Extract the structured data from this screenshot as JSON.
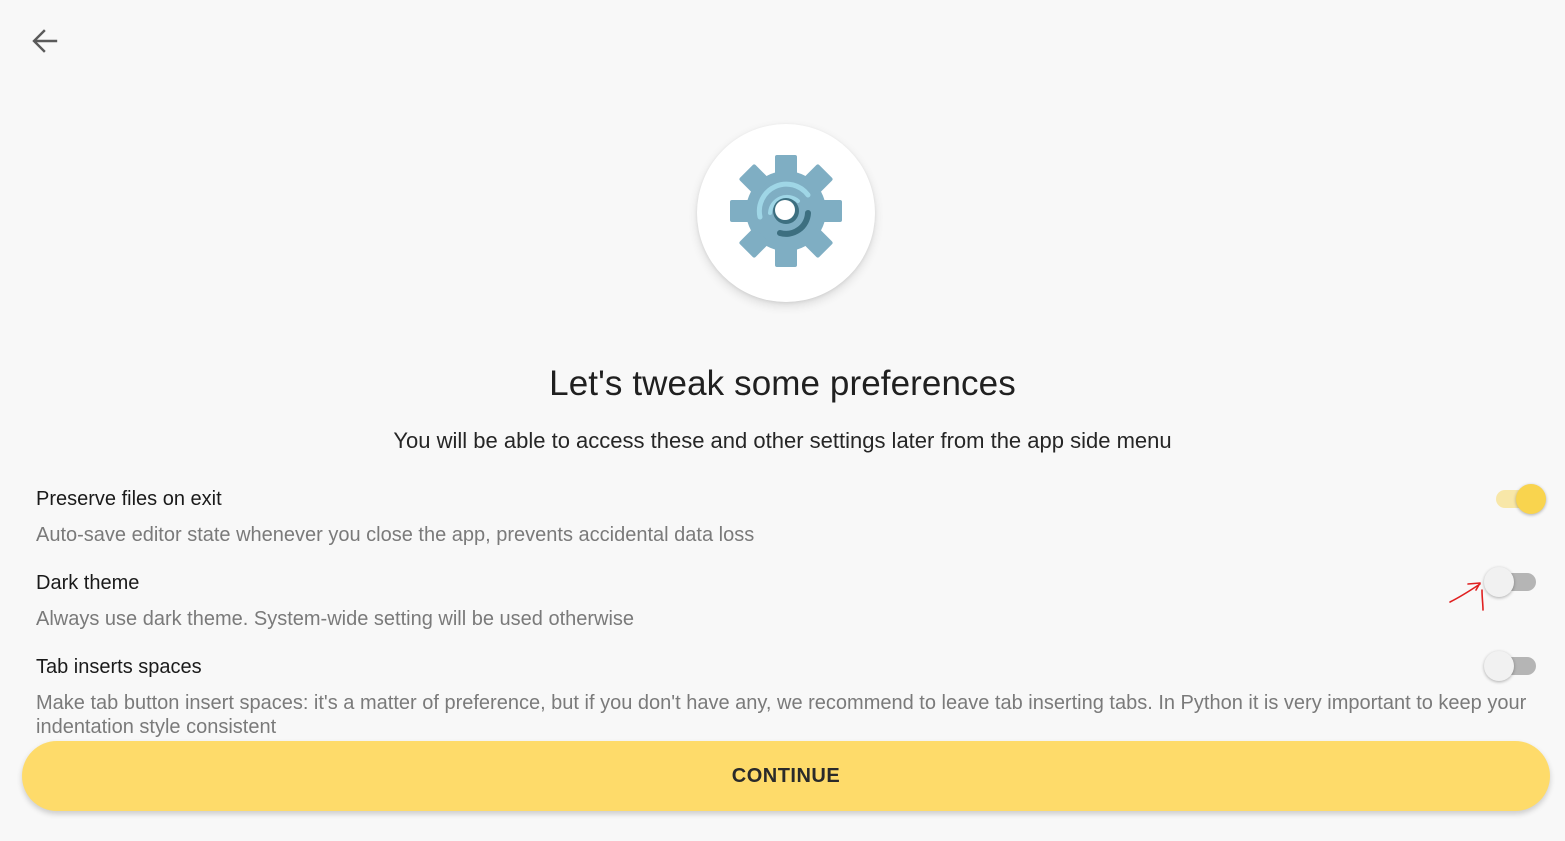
{
  "header": {
    "back_icon": "arrow-left-icon"
  },
  "hero": {
    "icon": "gear-icon",
    "colors": {
      "gear": "#7faec3",
      "arc_light": "#9fd6e6",
      "arc_dark": "#3d6f80"
    }
  },
  "title": "Let's tweak some preferences",
  "subtitle": "You will be able to access these and other settings later from the app side menu",
  "preferences": [
    {
      "title": "Preserve files on exit",
      "description": "Auto-save editor state whenever you close the app, prevents accidental data loss",
      "enabled": true
    },
    {
      "title": "Dark theme",
      "description": "Always use dark theme. System-wide setting will be used otherwise",
      "enabled": false
    },
    {
      "title": "Tab inserts spaces",
      "description": "Make tab button insert spaces: it's a matter of preference, but if you don't have any, we recommend to leave tab inserting tabs. In Python it is very important to keep your indentation style consistent",
      "enabled": false
    }
  ],
  "continue_button": {
    "label": "CONTINUE"
  },
  "colors": {
    "accent": "#fedb6a",
    "toggle_on_thumb": "#f9d44e",
    "toggle_on_track": "#f8e7a8",
    "toggle_off_track": "#b5b5b5",
    "background": "#f8f8f8",
    "annotation": "#e02020"
  },
  "annotation": {
    "icon": "red-hand-drawn-arrow-icon"
  }
}
